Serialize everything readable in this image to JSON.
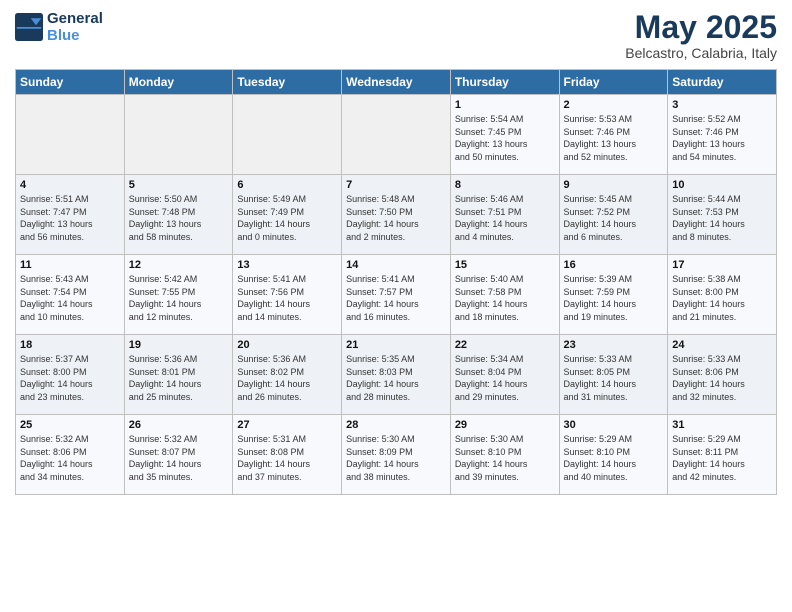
{
  "logo": {
    "line1": "General",
    "line2": "Blue"
  },
  "title": "May 2025",
  "subtitle": "Belcastro, Calabria, Italy",
  "headers": [
    "Sunday",
    "Monday",
    "Tuesday",
    "Wednesday",
    "Thursday",
    "Friday",
    "Saturday"
  ],
  "weeks": [
    [
      {
        "day": "",
        "detail": ""
      },
      {
        "day": "",
        "detail": ""
      },
      {
        "day": "",
        "detail": ""
      },
      {
        "day": "",
        "detail": ""
      },
      {
        "day": "1",
        "detail": "Sunrise: 5:54 AM\nSunset: 7:45 PM\nDaylight: 13 hours\nand 50 minutes."
      },
      {
        "day": "2",
        "detail": "Sunrise: 5:53 AM\nSunset: 7:46 PM\nDaylight: 13 hours\nand 52 minutes."
      },
      {
        "day": "3",
        "detail": "Sunrise: 5:52 AM\nSunset: 7:46 PM\nDaylight: 13 hours\nand 54 minutes."
      }
    ],
    [
      {
        "day": "4",
        "detail": "Sunrise: 5:51 AM\nSunset: 7:47 PM\nDaylight: 13 hours\nand 56 minutes."
      },
      {
        "day": "5",
        "detail": "Sunrise: 5:50 AM\nSunset: 7:48 PM\nDaylight: 13 hours\nand 58 minutes."
      },
      {
        "day": "6",
        "detail": "Sunrise: 5:49 AM\nSunset: 7:49 PM\nDaylight: 14 hours\nand 0 minutes."
      },
      {
        "day": "7",
        "detail": "Sunrise: 5:48 AM\nSunset: 7:50 PM\nDaylight: 14 hours\nand 2 minutes."
      },
      {
        "day": "8",
        "detail": "Sunrise: 5:46 AM\nSunset: 7:51 PM\nDaylight: 14 hours\nand 4 minutes."
      },
      {
        "day": "9",
        "detail": "Sunrise: 5:45 AM\nSunset: 7:52 PM\nDaylight: 14 hours\nand 6 minutes."
      },
      {
        "day": "10",
        "detail": "Sunrise: 5:44 AM\nSunset: 7:53 PM\nDaylight: 14 hours\nand 8 minutes."
      }
    ],
    [
      {
        "day": "11",
        "detail": "Sunrise: 5:43 AM\nSunset: 7:54 PM\nDaylight: 14 hours\nand 10 minutes."
      },
      {
        "day": "12",
        "detail": "Sunrise: 5:42 AM\nSunset: 7:55 PM\nDaylight: 14 hours\nand 12 minutes."
      },
      {
        "day": "13",
        "detail": "Sunrise: 5:41 AM\nSunset: 7:56 PM\nDaylight: 14 hours\nand 14 minutes."
      },
      {
        "day": "14",
        "detail": "Sunrise: 5:41 AM\nSunset: 7:57 PM\nDaylight: 14 hours\nand 16 minutes."
      },
      {
        "day": "15",
        "detail": "Sunrise: 5:40 AM\nSunset: 7:58 PM\nDaylight: 14 hours\nand 18 minutes."
      },
      {
        "day": "16",
        "detail": "Sunrise: 5:39 AM\nSunset: 7:59 PM\nDaylight: 14 hours\nand 19 minutes."
      },
      {
        "day": "17",
        "detail": "Sunrise: 5:38 AM\nSunset: 8:00 PM\nDaylight: 14 hours\nand 21 minutes."
      }
    ],
    [
      {
        "day": "18",
        "detail": "Sunrise: 5:37 AM\nSunset: 8:00 PM\nDaylight: 14 hours\nand 23 minutes."
      },
      {
        "day": "19",
        "detail": "Sunrise: 5:36 AM\nSunset: 8:01 PM\nDaylight: 14 hours\nand 25 minutes."
      },
      {
        "day": "20",
        "detail": "Sunrise: 5:36 AM\nSunset: 8:02 PM\nDaylight: 14 hours\nand 26 minutes."
      },
      {
        "day": "21",
        "detail": "Sunrise: 5:35 AM\nSunset: 8:03 PM\nDaylight: 14 hours\nand 28 minutes."
      },
      {
        "day": "22",
        "detail": "Sunrise: 5:34 AM\nSunset: 8:04 PM\nDaylight: 14 hours\nand 29 minutes."
      },
      {
        "day": "23",
        "detail": "Sunrise: 5:33 AM\nSunset: 8:05 PM\nDaylight: 14 hours\nand 31 minutes."
      },
      {
        "day": "24",
        "detail": "Sunrise: 5:33 AM\nSunset: 8:06 PM\nDaylight: 14 hours\nand 32 minutes."
      }
    ],
    [
      {
        "day": "25",
        "detail": "Sunrise: 5:32 AM\nSunset: 8:06 PM\nDaylight: 14 hours\nand 34 minutes."
      },
      {
        "day": "26",
        "detail": "Sunrise: 5:32 AM\nSunset: 8:07 PM\nDaylight: 14 hours\nand 35 minutes."
      },
      {
        "day": "27",
        "detail": "Sunrise: 5:31 AM\nSunset: 8:08 PM\nDaylight: 14 hours\nand 37 minutes."
      },
      {
        "day": "28",
        "detail": "Sunrise: 5:30 AM\nSunset: 8:09 PM\nDaylight: 14 hours\nand 38 minutes."
      },
      {
        "day": "29",
        "detail": "Sunrise: 5:30 AM\nSunset: 8:10 PM\nDaylight: 14 hours\nand 39 minutes."
      },
      {
        "day": "30",
        "detail": "Sunrise: 5:29 AM\nSunset: 8:10 PM\nDaylight: 14 hours\nand 40 minutes."
      },
      {
        "day": "31",
        "detail": "Sunrise: 5:29 AM\nSunset: 8:11 PM\nDaylight: 14 hours\nand 42 minutes."
      }
    ]
  ]
}
